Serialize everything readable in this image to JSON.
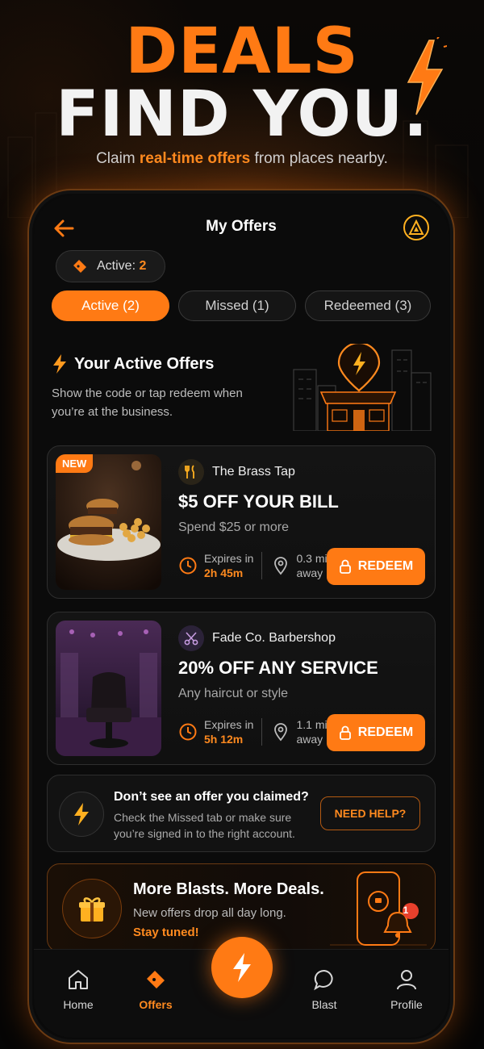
{
  "hero": {
    "line1": "DEALS",
    "line2": "FIND YOU.",
    "subtitle_pre": "Claim ",
    "subtitle_highlight": "real-time offers",
    "subtitle_post": " from places nearby."
  },
  "header": {
    "title": "My Offers"
  },
  "active_pill": {
    "label": "Active: ",
    "count": "2"
  },
  "tabs": [
    {
      "label": "Active (2)",
      "active": true
    },
    {
      "label": "Missed (1)",
      "active": false
    },
    {
      "label": "Redeemed (3)",
      "active": false
    }
  ],
  "section": {
    "title": "Your Active Offers",
    "description": "Show the code or tap redeem when you’re at the business."
  },
  "offers": [
    {
      "badge": "NEW",
      "business": "The Brass Tap",
      "title": "$5 OFF YOUR BILL",
      "subtitle": "Spend $25 or more",
      "expires_label": "Expires in",
      "expires_value": "2h 45m",
      "distance_value": "0.3 mi",
      "distance_label": "away",
      "redeem_label": "REDEEM"
    },
    {
      "business": "Fade Co. Barbershop",
      "title": "20% OFF ANY SERVICE",
      "subtitle": "Any haircut or style",
      "expires_label": "Expires in",
      "expires_value": "5h 12m",
      "distance_value": "1.1 mi",
      "distance_label": "away",
      "redeem_label": "REDEEM"
    }
  ],
  "help": {
    "title": "Don’t see an offer you claimed?",
    "description": "Check the Missed tab or make sure you’re signed in to the right account.",
    "button": "NEED HELP?"
  },
  "promo": {
    "title": "More Blasts. More Deals.",
    "description": "New offers drop all day long.",
    "cta": "Stay tuned!",
    "notification_count": "1"
  },
  "nav": [
    {
      "label": "Home",
      "icon": "home-icon"
    },
    {
      "label": "Offers",
      "icon": "ticket-icon",
      "active": true
    },
    {
      "label": "Blast",
      "icon": "chat-bubble-icon"
    },
    {
      "label": "Profile",
      "icon": "user-icon"
    }
  ],
  "colors": {
    "accent": "#ff7a14",
    "background": "#0b0b0b",
    "card": "#141414"
  }
}
